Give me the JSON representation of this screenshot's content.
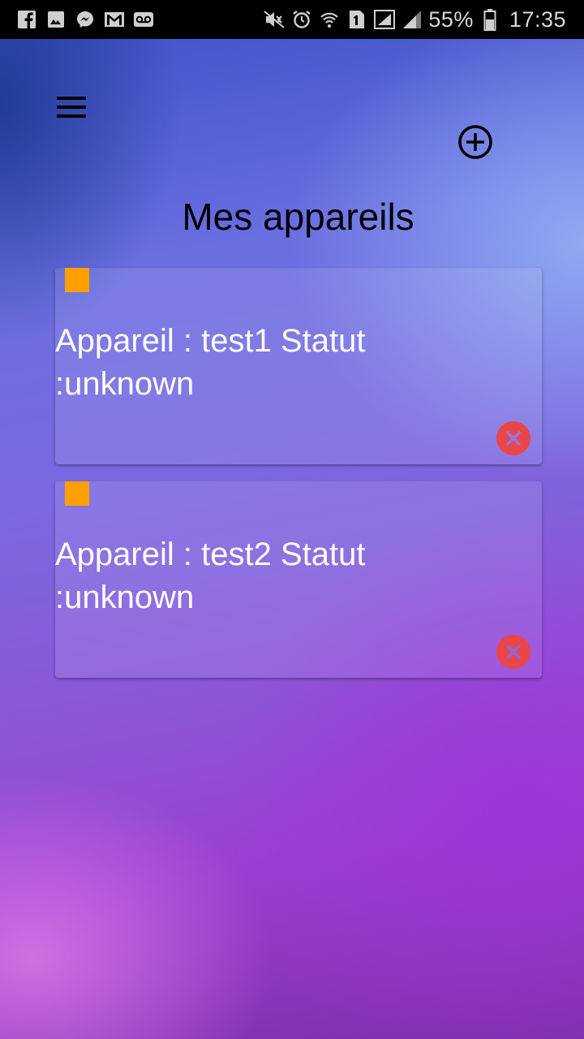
{
  "status_bar": {
    "battery_percent": "55%",
    "time": "17:35",
    "left_icons": [
      "facebook-icon",
      "gallery-icon",
      "messenger-icon",
      "gmail-icon",
      "voicemail-icon"
    ],
    "right_icons": [
      "mute-icon",
      "alarm-icon",
      "wifi-icon",
      "sim-icon",
      "signal-icon",
      "battery-icon"
    ]
  },
  "header": {
    "title": "Mes appareils",
    "menu_icon": "hamburger-menu-icon",
    "add_icon": "add-circle-icon"
  },
  "devices": [
    {
      "text": "Appareil : test1 Statut :unknown",
      "status_color": "#ff9f00"
    },
    {
      "text": "Appareil : test2 Statut :unknown",
      "status_color": "#ff9f00"
    }
  ],
  "colors": {
    "status_indicator": "#ff9f00",
    "delete_button": "#ea4549"
  }
}
